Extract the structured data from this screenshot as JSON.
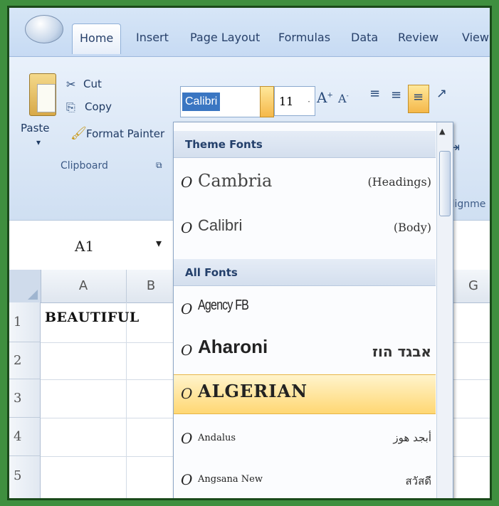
{
  "ribbon": {
    "tabs": [
      {
        "label": "Home",
        "active": true
      },
      {
        "label": "Insert"
      },
      {
        "label": "Page Layout"
      },
      {
        "label": "Formulas"
      },
      {
        "label": "Data"
      },
      {
        "label": "Review"
      },
      {
        "label": "View"
      }
    ],
    "clipboard": {
      "paste": "Paste",
      "cut": "Cut",
      "copy": "Copy",
      "format_painter": "Format Painter",
      "group_label": "Clipboard"
    },
    "font": {
      "name": "Calibri",
      "size": "11"
    },
    "alignment_label": "Alignme"
  },
  "formula_bar": {
    "name_box": "A1"
  },
  "grid": {
    "columns": [
      "A",
      "B",
      "G"
    ],
    "rows": [
      "1",
      "2",
      "3",
      "4",
      "5"
    ],
    "cells": {
      "A1": "BEAUTIFUL"
    }
  },
  "font_dropdown": {
    "theme_header": "Theme Fonts",
    "theme_fonts": [
      {
        "name": "Cambria",
        "tag": "(Headings)"
      },
      {
        "name": "Calibri",
        "tag": "(Body)"
      }
    ],
    "all_header": "All Fonts",
    "all_fonts": [
      {
        "name": "Agency FB",
        "tag": ""
      },
      {
        "name": "Aharoni",
        "tag": "אבגד הוז"
      },
      {
        "name": "ALGERIAN",
        "tag": "",
        "highlighted": true
      },
      {
        "name": "Andalus",
        "tag": "أبجد هوز"
      },
      {
        "name": "Angsana New",
        "tag": "สวัสดี"
      }
    ],
    "icon_glyph": "O"
  }
}
